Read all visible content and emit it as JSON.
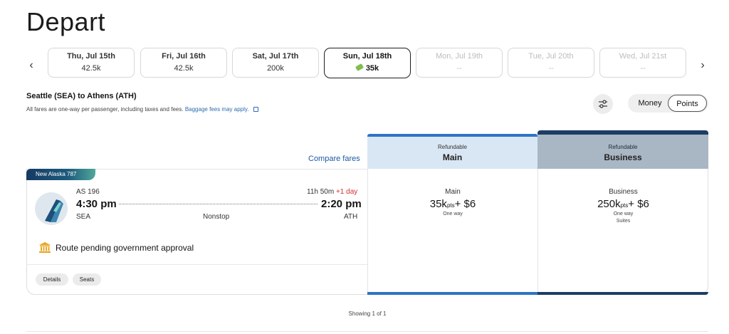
{
  "page": {
    "title": "Depart"
  },
  "date_strip": {
    "prev_icon": "chevron-left-icon",
    "next_icon": "chevron-right-icon",
    "dates": [
      {
        "label": "Thu, Jul 15th",
        "price": "42.5k",
        "state": "available"
      },
      {
        "label": "Fri, Jul 16th",
        "price": "42.5k",
        "state": "available"
      },
      {
        "label": "Sat, Jul 17th",
        "price": "200k",
        "state": "available"
      },
      {
        "label": "Sun, Jul 18th",
        "price": "35k",
        "state": "selected"
      },
      {
        "label": "Mon, Jul 19th",
        "price": "--",
        "state": "disabled"
      },
      {
        "label": "Tue, Jul 20th",
        "price": "--",
        "state": "disabled"
      },
      {
        "label": "Wed, Jul 21st",
        "price": "--",
        "state": "disabled"
      }
    ]
  },
  "route": {
    "title": "Seattle (SEA) to Athens (ATH)",
    "note": "All fares are one-way per passenger, including taxes and fees.",
    "baggage_link": "Baggage fees may apply."
  },
  "controls": {
    "filter_icon": "sliders-icon",
    "toggle": {
      "money": "Money",
      "points": "Points",
      "selected": "Points"
    }
  },
  "compare_fares": "Compare fares",
  "columns": {
    "main": {
      "refund": "Refundable",
      "cabin": "Main",
      "color": "#2d74c4"
    },
    "business": {
      "refund": "Refundable",
      "cabin": "Business",
      "color": "#1c3d64"
    }
  },
  "flight": {
    "badge": "New Alaska 787",
    "flight_number": "AS 196",
    "duration": "11h 50m",
    "day_offset": "+1 day",
    "depart_time": "4:30 pm",
    "arrive_time": "2:20 pm",
    "origin": "SEA",
    "destination": "ATH",
    "stops": "Nonstop",
    "notice": "Route pending government approval",
    "buttons": {
      "details": "Details",
      "seats": "Seats"
    },
    "fares": {
      "main": {
        "name": "Main",
        "points": "35k",
        "pts_unit": "pts",
        "cash": "+ $6",
        "note": "One way",
        "extra": ""
      },
      "business": {
        "name": "Business",
        "points": "250k",
        "pts_unit": "pts",
        "cash": "+ $6",
        "note": "One way",
        "extra": "Suites"
      }
    }
  },
  "results": {
    "showing": "Showing 1 of 1"
  }
}
